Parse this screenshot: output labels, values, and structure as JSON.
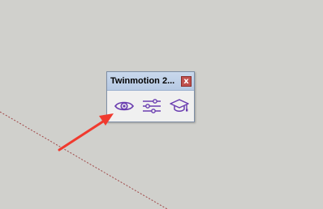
{
  "toolbar": {
    "title": "Twinmotion 2...",
    "close_symbol": "x",
    "buttons": [
      {
        "name": "view-icon",
        "icon": "eye-icon"
      },
      {
        "name": "settings-icon",
        "icon": "sliders-icon"
      },
      {
        "name": "learn-icon",
        "icon": "graduation-cap-icon"
      }
    ]
  },
  "colors": {
    "icon": "#6a3db0",
    "arrow": "#f03a2e",
    "axis": "#a04040"
  }
}
